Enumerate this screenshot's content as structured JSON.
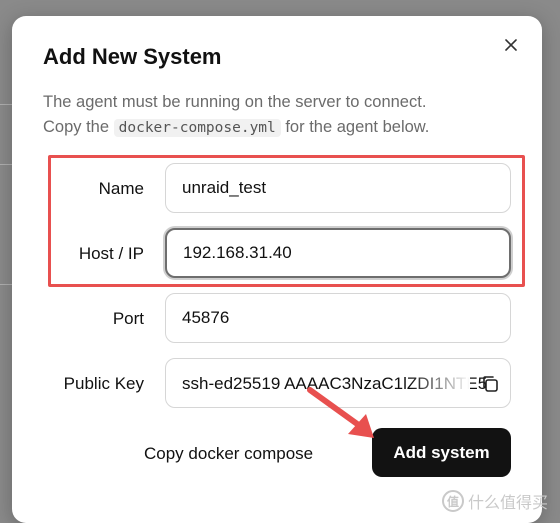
{
  "dialog": {
    "title": "Add New System",
    "description_line1": "The agent must be running on the server to connect.",
    "description_pre": "Copy the ",
    "description_code": "docker-compose.yml",
    "description_post": " for the agent below."
  },
  "form": {
    "name_label": "Name",
    "name_value": "unraid_test",
    "host_label": "Host / IP",
    "host_value": "192.168.31.40",
    "port_label": "Port",
    "port_value": "45876",
    "key_label": "Public Key",
    "key_value": "ssh-ed25519 AAAAC3NzaC1lZDI1NTE5"
  },
  "actions": {
    "copy_compose_label": "Copy docker compose",
    "add_label": "Add system"
  },
  "icons": {
    "close": "close-icon",
    "copy": "copy-icon"
  },
  "annotation": {
    "highlight_color": "#e8504f"
  },
  "watermark": {
    "badge_text": "值",
    "text": "什么值得买"
  }
}
